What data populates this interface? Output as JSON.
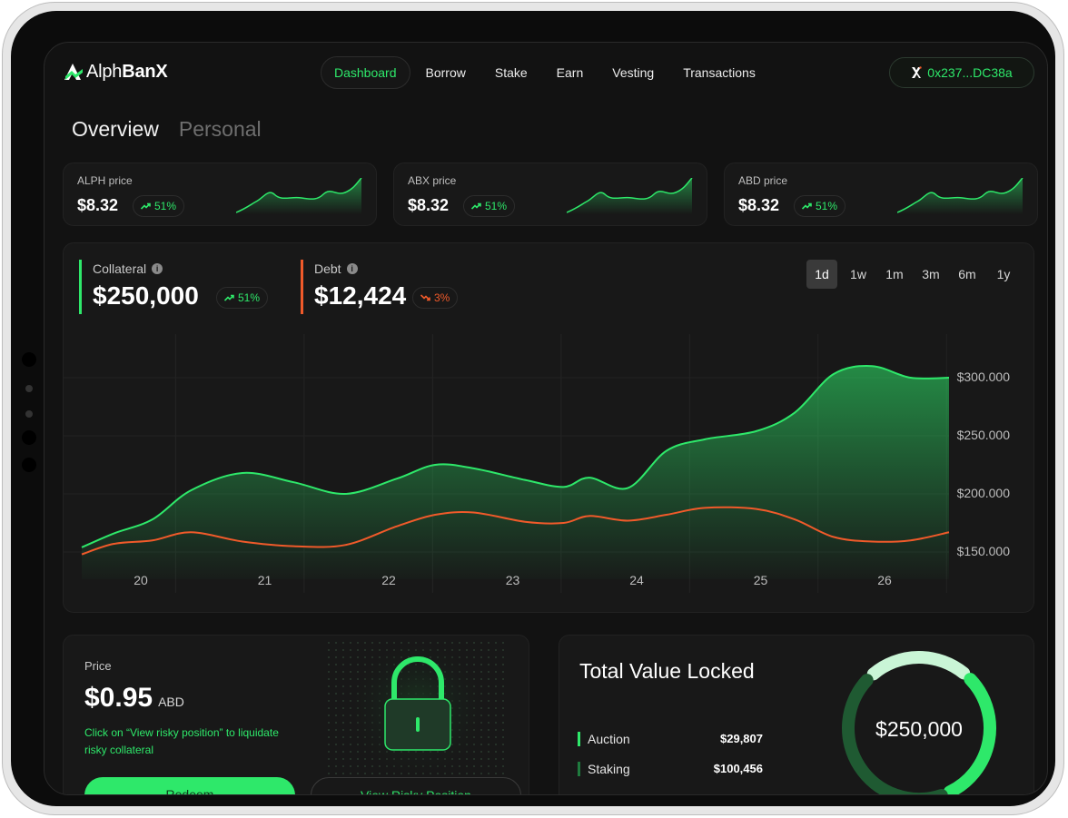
{
  "app": {
    "logo_text_light": "Alph",
    "logo_text_bold": "BanX",
    "wallet_address": "0x237...DC38a"
  },
  "nav": {
    "items": [
      {
        "label": "Dashboard",
        "active": true
      },
      {
        "label": "Borrow",
        "active": false
      },
      {
        "label": "Stake",
        "active": false
      },
      {
        "label": "Earn",
        "active": false
      },
      {
        "label": "Vesting",
        "active": false
      },
      {
        "label": "Transactions",
        "active": false
      }
    ]
  },
  "tabs": [
    {
      "label": "Overview",
      "active": true
    },
    {
      "label": "Personal",
      "active": false
    }
  ],
  "price_cards": [
    {
      "label": "ALPH price",
      "value": "$8.32",
      "change": "51%",
      "direction": "up"
    },
    {
      "label": "ABX price",
      "value": "$8.32",
      "change": "51%",
      "direction": "up"
    },
    {
      "label": "ABD price",
      "value": "$8.32",
      "change": "51%",
      "direction": "up"
    }
  ],
  "overview_chart": {
    "collateral": {
      "label": "Collateral",
      "value": "$250,000",
      "change": "51%",
      "direction": "up"
    },
    "debt": {
      "label": "Debt",
      "value": "$12,424",
      "change": "3%",
      "direction": "down"
    },
    "ranges": [
      {
        "label": "1d",
        "active": true
      },
      {
        "label": "1w",
        "active": false
      },
      {
        "label": "1m",
        "active": false
      },
      {
        "label": "3m",
        "active": false
      },
      {
        "label": "6m",
        "active": false
      },
      {
        "label": "1y",
        "active": false
      }
    ]
  },
  "chart_data": {
    "type": "area",
    "x_ticks": [
      "20",
      "21",
      "22",
      "23",
      "24",
      "25",
      "26"
    ],
    "y_ticks": [
      "$300.000",
      "$250.000",
      "$200.000",
      "$150.000"
    ],
    "ylim": [
      150000,
      300000
    ],
    "grid": true,
    "series": [
      {
        "name": "Collateral",
        "color": "#2ee86a",
        "x": [
          19.75,
          20.0,
          20.3,
          20.6,
          21.0,
          21.4,
          21.8,
          22.2,
          22.5,
          22.8,
          23.2,
          23.5,
          23.7,
          24.0,
          24.3,
          24.6,
          25.0,
          25.3,
          25.6,
          25.9,
          26.2,
          26.5
        ],
        "values": [
          154000,
          166000,
          178000,
          203000,
          218000,
          210000,
          200000,
          213000,
          225000,
          222000,
          212000,
          206000,
          214000,
          205000,
          237000,
          247000,
          254000,
          270000,
          303000,
          310000,
          300000,
          300000
        ]
      },
      {
        "name": "Debt",
        "color": "#f05a2a",
        "x": [
          19.75,
          20.0,
          20.3,
          20.6,
          21.0,
          21.4,
          21.8,
          22.2,
          22.5,
          22.8,
          23.2,
          23.5,
          23.7,
          24.0,
          24.3,
          24.6,
          25.0,
          25.3,
          25.6,
          25.9,
          26.2,
          26.5
        ],
        "values": [
          148000,
          157000,
          160000,
          167000,
          159000,
          155000,
          156000,
          172000,
          182000,
          184000,
          176000,
          175000,
          181000,
          177000,
          182000,
          188000,
          187000,
          178000,
          163000,
          159000,
          160000,
          167000
        ]
      }
    ]
  },
  "price_panel": {
    "label": "Price",
    "value": "$0.95",
    "unit": "ABD",
    "note": "Click on “View risky position” to liquidate risky collateral",
    "redeem_label": "Redeem",
    "risky_label": "View Risky Position"
  },
  "tvl": {
    "title": "Total Value Locked",
    "total": "$250,000",
    "rows": [
      {
        "name": "Auction",
        "value": "$29,807",
        "color": "#2ee86a"
      },
      {
        "name": "Staking",
        "value": "$100,456",
        "color": "#1f7a3e"
      }
    ],
    "segments": [
      {
        "name": "light",
        "fraction": 0.22,
        "color": "#c9f5d6"
      },
      {
        "name": "bright",
        "fraction": 0.3,
        "color": "#2ee86a"
      },
      {
        "name": "dark",
        "fraction": 0.42,
        "color": "#1f5a32"
      }
    ]
  }
}
